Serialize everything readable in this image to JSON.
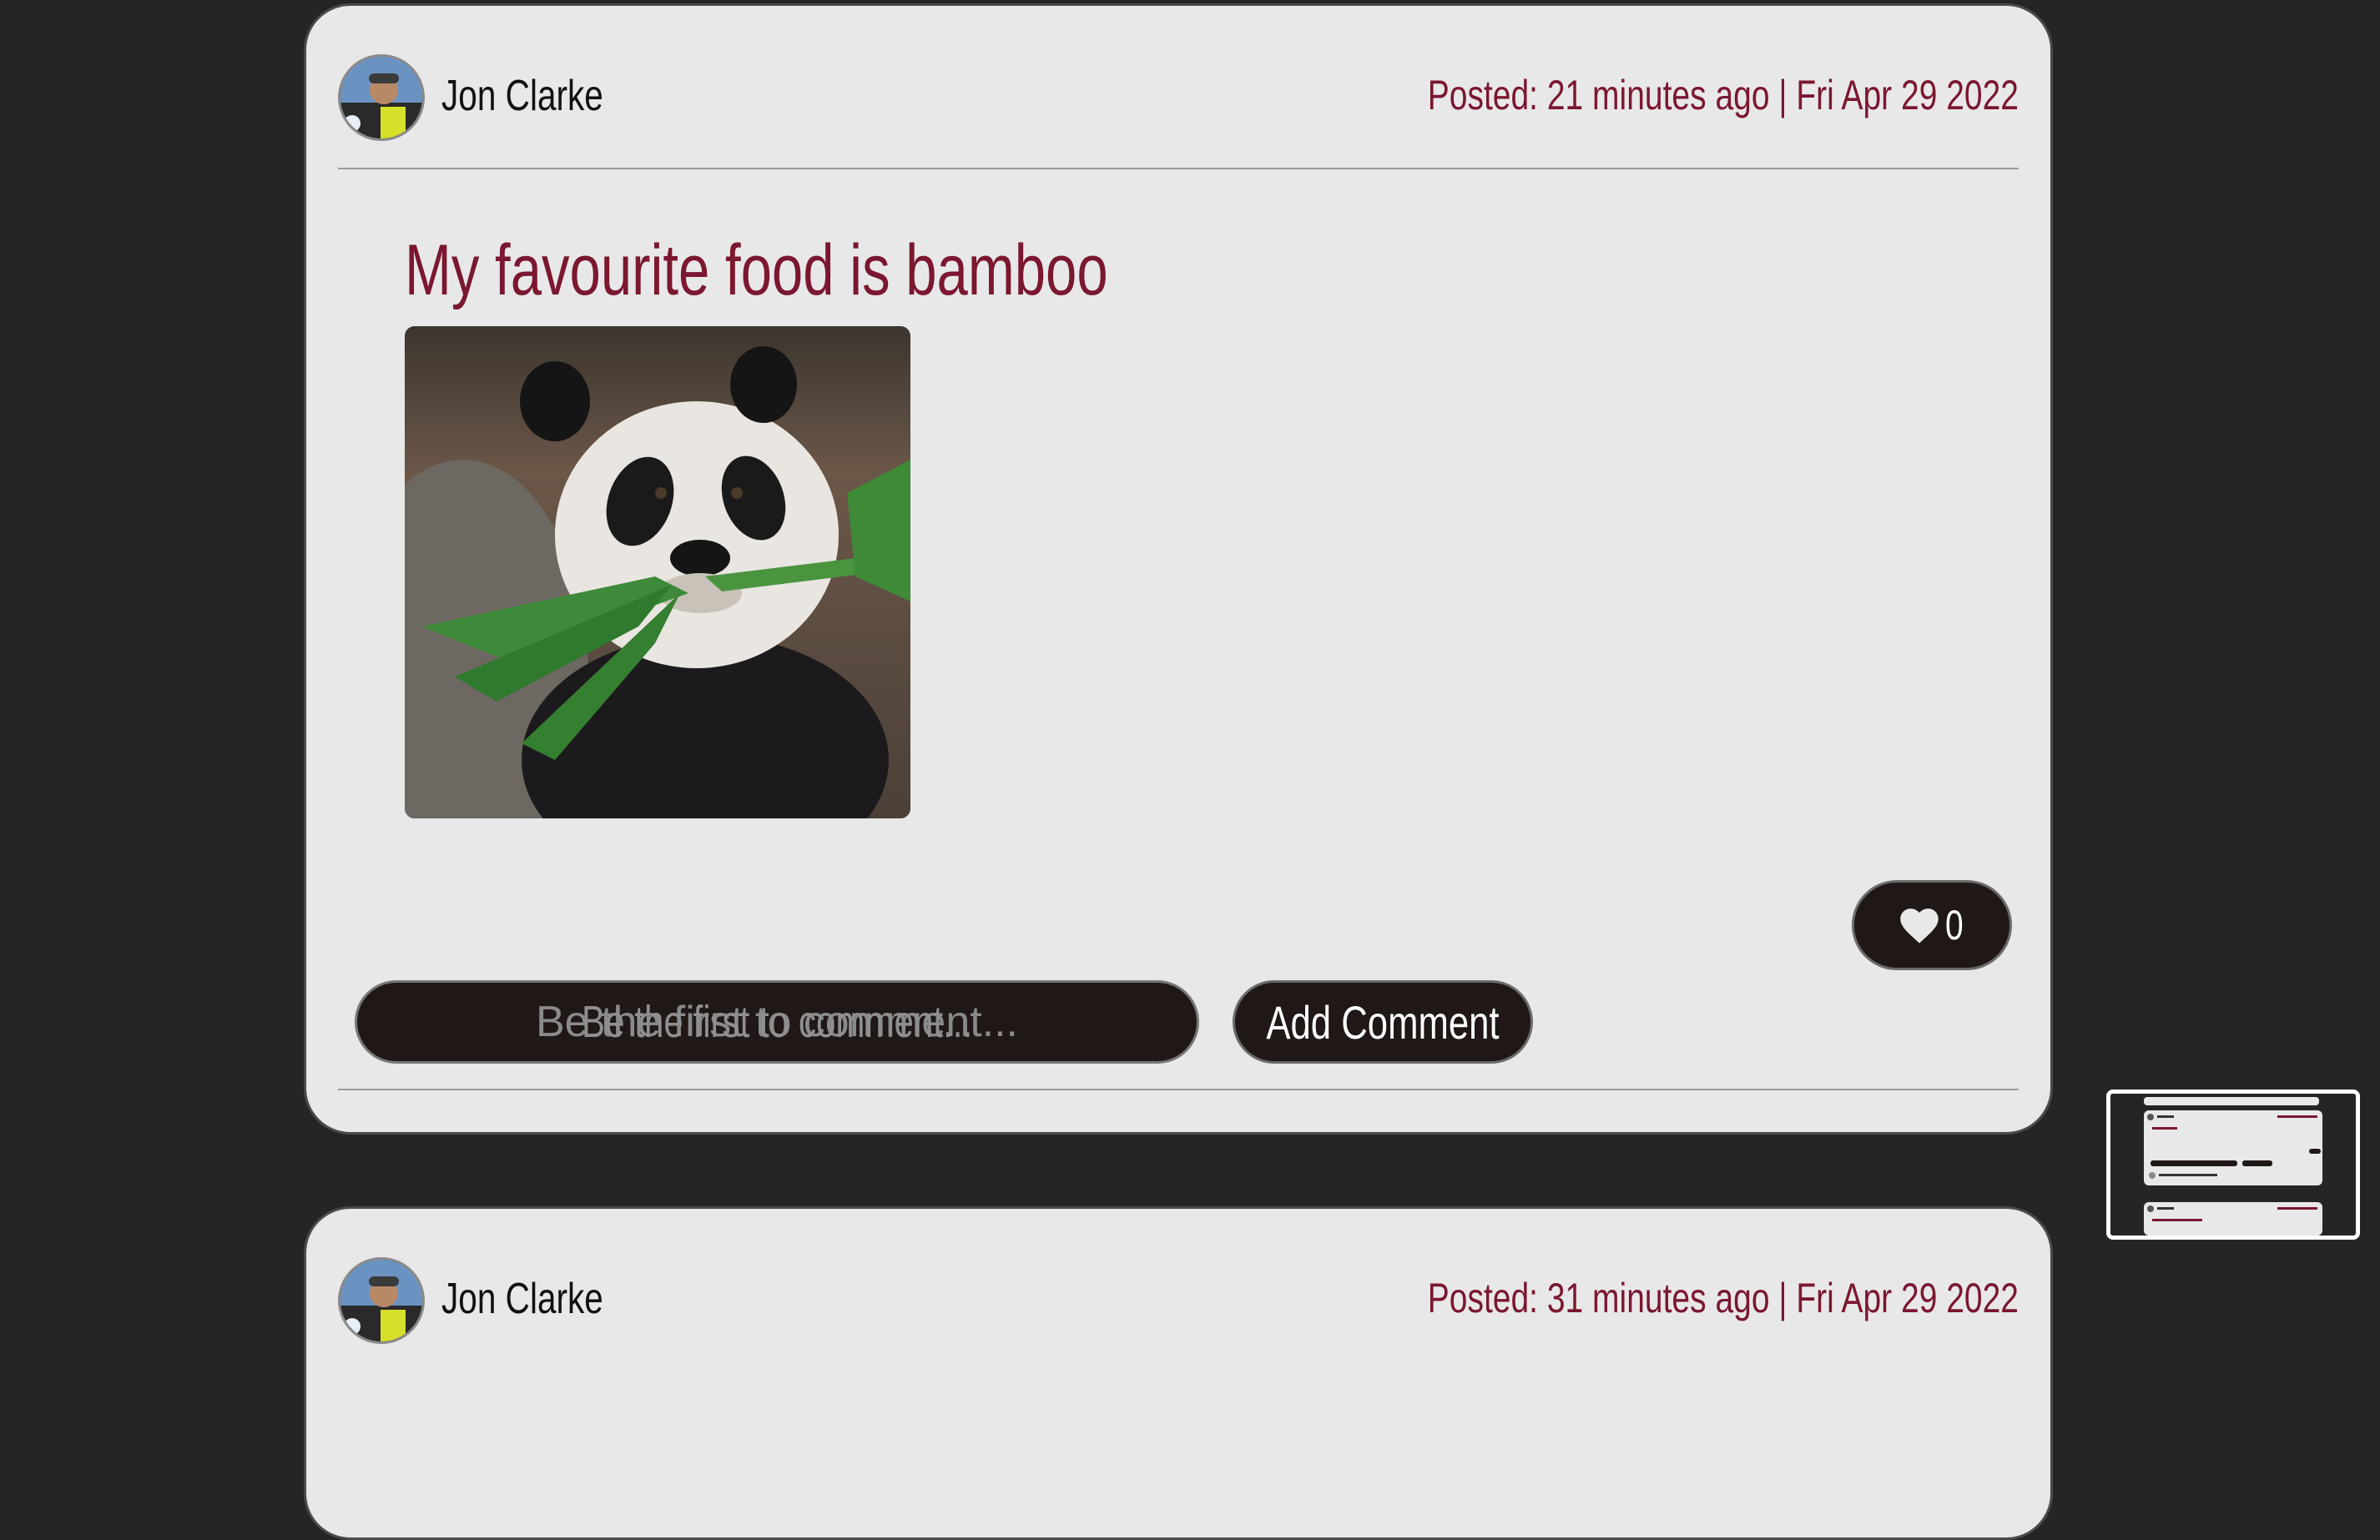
{
  "colors": {
    "page_background": "#252525",
    "card_background": "#e8e8e8",
    "accent_text": "#7b1730",
    "button_background": "#201816",
    "button_text": "#ffffff"
  },
  "posts": [
    {
      "author": "Jon Clarke",
      "posted": "Posted: 21 minutes ago | Fri Apr 29 2022",
      "title": "My favourite food is bamboo",
      "image_subject": "panda-eating-bamboo",
      "like_icon": "heart-icon",
      "likes": "0",
      "comment_placeholder": "Be the first to comment...",
      "add_comment_label": "Add Comment"
    },
    {
      "author": "Jon Clarke",
      "posted": "Posted: 31 minutes ago | Fri Apr 29 2022"
    }
  ],
  "minimap": {
    "description_icon": "page-preview-thumbnail"
  }
}
